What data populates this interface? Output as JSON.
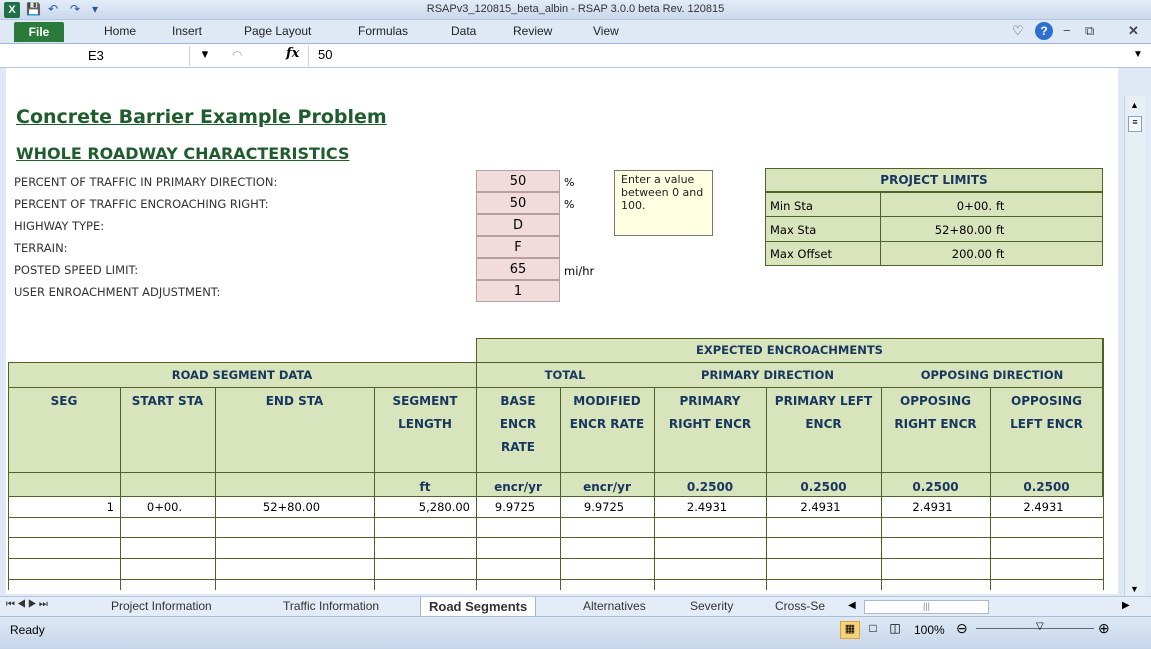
{
  "window": {
    "title": "RSAPv3_120815_beta_albin - RSAP 3.0.0 beta Rev. 120815"
  },
  "ribbon": {
    "file": "File",
    "tabs": [
      "Home",
      "Insert",
      "Page Layout",
      "Formulas",
      "Data",
      "Review",
      "View"
    ]
  },
  "formula": {
    "cell": "E3",
    "fx": "fx",
    "value": "50"
  },
  "sheet": {
    "title": "Concrete Barrier Example Problem",
    "section": "WHOLE ROADWAY CHARACTERISTICS",
    "params": [
      {
        "label": "PERCENT OF TRAFFIC IN PRIMARY DIRECTION:",
        "value": "50",
        "unit": "%"
      },
      {
        "label": "PERCENT OF TRAFFIC ENCROACHING RIGHT:",
        "value": "50",
        "unit": "%"
      },
      {
        "label": "HIGHWAY TYPE:",
        "value": "D",
        "unit": ""
      },
      {
        "label": "TERRAIN:",
        "value": "F",
        "unit": ""
      },
      {
        "label": "POSTED SPEED LIMIT:",
        "value": "65",
        "unit": "mi/hr"
      },
      {
        "label": "USER ENROACHMENT ADJUSTMENT:",
        "value": "1",
        "unit": ""
      }
    ],
    "tooltip": "Enter a value between 0 and 100.",
    "limits": {
      "title": "PROJECT LIMITS",
      "rows": [
        {
          "label": "Min Sta",
          "value": "0+00.",
          "unit": "ft"
        },
        {
          "label": "Max Sta",
          "value": "52+80.00",
          "unit": "ft"
        },
        {
          "label": "Max Offset",
          "value": "200.00",
          "unit": "ft"
        }
      ]
    },
    "table": {
      "expected": "EXPECTED ENCROACHMENTS",
      "road_segment_data": "ROAD SEGMENT DATA",
      "total": "TOTAL",
      "primary_direction": "PRIMARY DIRECTION",
      "opposing_direction": "OPPOSING DIRECTION",
      "columns": [
        {
          "h1": "SEG",
          "h2": "",
          "h3": "",
          "unit": ""
        },
        {
          "h1": "START STA",
          "h2": "",
          "h3": "",
          "unit": ""
        },
        {
          "h1": "END STA",
          "h2": "",
          "h3": "",
          "unit": ""
        },
        {
          "h1": "SEGMENT",
          "h2": "LENGTH",
          "h3": "",
          "unit": "ft"
        },
        {
          "h1": "BASE",
          "h2": "ENCR",
          "h3": "RATE",
          "unit": "encr/yr"
        },
        {
          "h1": "MODIFIED",
          "h2": "ENCR RATE",
          "h3": "",
          "unit": "encr/yr"
        },
        {
          "h1": "PRIMARY",
          "h2": "RIGHT ENCR",
          "h3": "",
          "unit": "0.2500"
        },
        {
          "h1": "PRIMARY LEFT",
          "h2": "ENCR",
          "h3": "",
          "unit": "0.2500"
        },
        {
          "h1": "OPPOSING",
          "h2": "RIGHT ENCR",
          "h3": "",
          "unit": "0.2500"
        },
        {
          "h1": "OPPOSING",
          "h2": "LEFT  ENCR",
          "h3": "",
          "unit": "0.2500"
        }
      ],
      "rows": [
        [
          "1",
          "0+00.",
          "52+80.00",
          "5,280.00",
          "9.9725",
          "9.9725",
          "2.4931",
          "2.4931",
          "2.4931",
          "2.4931"
        ]
      ]
    }
  },
  "sheettabs": {
    "tabs": [
      "Project Information",
      "Traffic Information",
      "Road Segments",
      "Alternatives",
      "Severity",
      "Cross-Se"
    ],
    "active": "Road Segments"
  },
  "status": {
    "ready": "Ready",
    "zoom": "100%"
  }
}
